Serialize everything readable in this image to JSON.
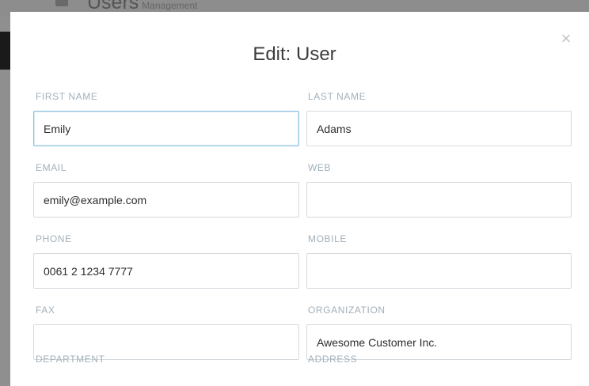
{
  "background": {
    "page_title": "Users",
    "page_subtitle": "Management"
  },
  "modal": {
    "title": "Edit: User",
    "close_glyph": "×"
  },
  "fields": {
    "first_name": {
      "label": "FIRST NAME",
      "value": "Emily"
    },
    "last_name": {
      "label": "LAST NAME",
      "value": "Adams"
    },
    "email": {
      "label": "EMAIL",
      "value": "emily@example.com"
    },
    "web": {
      "label": "WEB",
      "value": ""
    },
    "phone": {
      "label": "PHONE",
      "value": "0061 2 1234 7777"
    },
    "mobile": {
      "label": "MOBILE",
      "value": ""
    },
    "fax": {
      "label": "FAX",
      "value": ""
    },
    "organization": {
      "label": "ORGANIZATION",
      "value": "Awesome Customer Inc."
    },
    "department": {
      "label": "DEPARTMENT"
    },
    "address": {
      "label": "ADDRESS"
    }
  },
  "colors": {
    "label": "#a2b0bb",
    "focus_border": "#8fc2e0",
    "overlay": "#8f8f8f"
  }
}
